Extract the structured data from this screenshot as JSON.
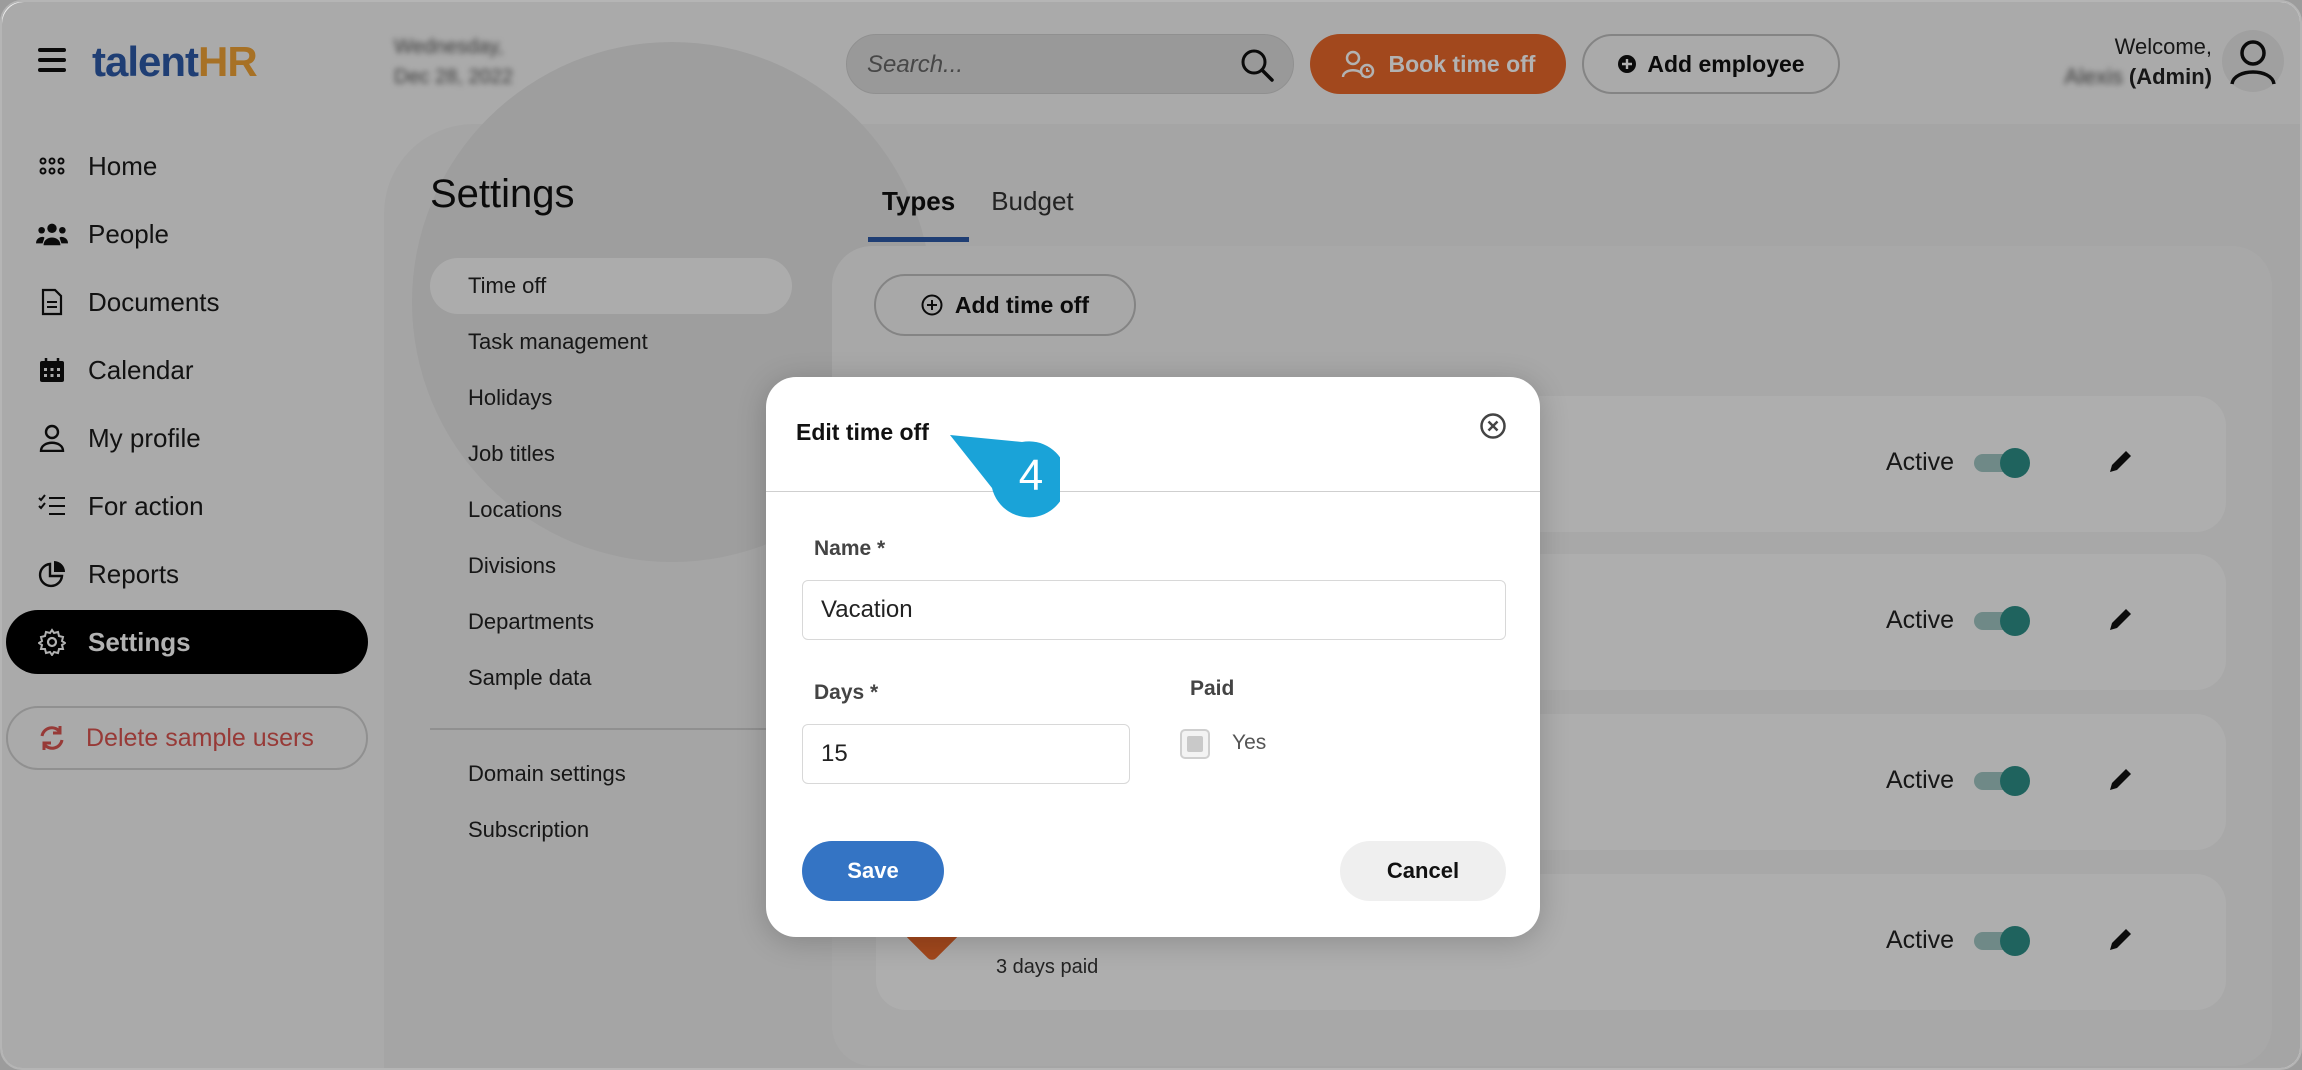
{
  "app": {
    "logo_main": "talent",
    "logo_accent": "HR"
  },
  "header": {
    "date_line1": "Wednesday,",
    "date_line2": "Dec 28, 2022",
    "search_placeholder": "Search...",
    "book_label": "Book time off",
    "add_employee_label": "Add employee",
    "welcome": "Welcome,",
    "user_name": "Alexis",
    "user_role": "(Admin)"
  },
  "nav": {
    "items": [
      {
        "label": "Home",
        "icon": "grid-icon"
      },
      {
        "label": "People",
        "icon": "people-icon"
      },
      {
        "label": "Documents",
        "icon": "document-icon"
      },
      {
        "label": "Calendar",
        "icon": "calendar-icon"
      },
      {
        "label": "My profile",
        "icon": "user-icon"
      },
      {
        "label": "For action",
        "icon": "checklist-icon"
      },
      {
        "label": "Reports",
        "icon": "pie-chart-icon"
      },
      {
        "label": "Settings",
        "icon": "gear-icon"
      }
    ],
    "delete_label": "Delete sample users"
  },
  "settings": {
    "title": "Settings",
    "submenu": [
      "Time off",
      "Task management",
      "Holidays",
      "Job titles",
      "Locations",
      "Divisions",
      "Departments",
      "Sample data"
    ],
    "submenu_bottom": [
      "Domain settings",
      "Subscription"
    ]
  },
  "tabs": [
    "Types",
    "Budget"
  ],
  "panel": {
    "add_label": "Add time off",
    "rows": [
      {
        "status": "Active",
        "sub": ""
      },
      {
        "status": "Active",
        "sub": ""
      },
      {
        "status": "Active",
        "sub": ""
      },
      {
        "status": "Active",
        "sub": "3 days paid"
      }
    ]
  },
  "modal": {
    "title": "Edit time off",
    "name_label": "Name *",
    "name_value": "Vacation",
    "days_label": "Days *",
    "days_value": "15",
    "paid_label": "Paid",
    "paid_option": "Yes",
    "save_label": "Save",
    "cancel_label": "Cancel"
  },
  "callout": {
    "step": "4"
  },
  "colors": {
    "accent_orange": "#e8672a",
    "accent_blue": "#3474c4",
    "toggle_teal": "#2d8f87",
    "callout_blue": "#1aa3d8"
  }
}
